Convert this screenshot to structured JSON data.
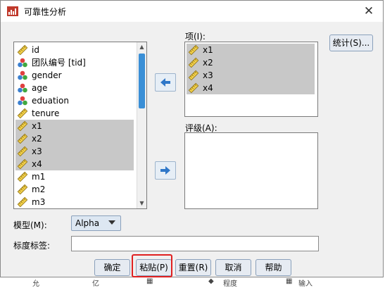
{
  "window": {
    "title": "可靠性分析",
    "close_glyph": "✕"
  },
  "source_list": {
    "items": [
      {
        "label": "id",
        "icon": "ruler-icon",
        "selected": false
      },
      {
        "label": "团队编号 [tid]",
        "icon": "nominal-venn-icon",
        "selected": false
      },
      {
        "label": "gender",
        "icon": "nominal-balls-icon",
        "selected": false
      },
      {
        "label": "age",
        "icon": "nominal-balls-icon",
        "selected": false
      },
      {
        "label": "eduation",
        "icon": "nominal-balls-icon",
        "selected": false
      },
      {
        "label": "tenure",
        "icon": "ruler-icon",
        "selected": false
      },
      {
        "label": "x1",
        "icon": "ruler-icon",
        "selected": true
      },
      {
        "label": "x2",
        "icon": "ruler-icon",
        "selected": true
      },
      {
        "label": "x3",
        "icon": "ruler-icon",
        "selected": true
      },
      {
        "label": "x4",
        "icon": "ruler-icon",
        "selected": true
      },
      {
        "label": "m1",
        "icon": "ruler-icon",
        "selected": false
      },
      {
        "label": "m2",
        "icon": "ruler-icon",
        "selected": false
      },
      {
        "label": "m3",
        "icon": "ruler-icon",
        "selected": false
      }
    ]
  },
  "items_list": {
    "label": "项(I):",
    "items": [
      {
        "label": "x1",
        "icon": "ruler-icon"
      },
      {
        "label": "x2",
        "icon": "ruler-icon"
      },
      {
        "label": "x3",
        "icon": "ruler-icon"
      },
      {
        "label": "x4",
        "icon": "ruler-icon"
      }
    ]
  },
  "rater_list": {
    "label": "评级(A):"
  },
  "statistics_button": "统计(S)...",
  "model": {
    "label": "模型(M):",
    "value": "Alpha"
  },
  "scale_label": {
    "label": "标度标签:",
    "value": ""
  },
  "buttons": {
    "ok": "确定",
    "paste": "粘贴(P)",
    "reset": "重置(R)",
    "cancel": "取消",
    "help": "帮助"
  },
  "background_fragments": [
    "允",
    "亿",
    "▦",
    "◆",
    "程度",
    "▦",
    "输入"
  ],
  "colors": {
    "accent": "#3a8fd6",
    "selection": "#c8c8c8",
    "highlight": "#e02020"
  }
}
